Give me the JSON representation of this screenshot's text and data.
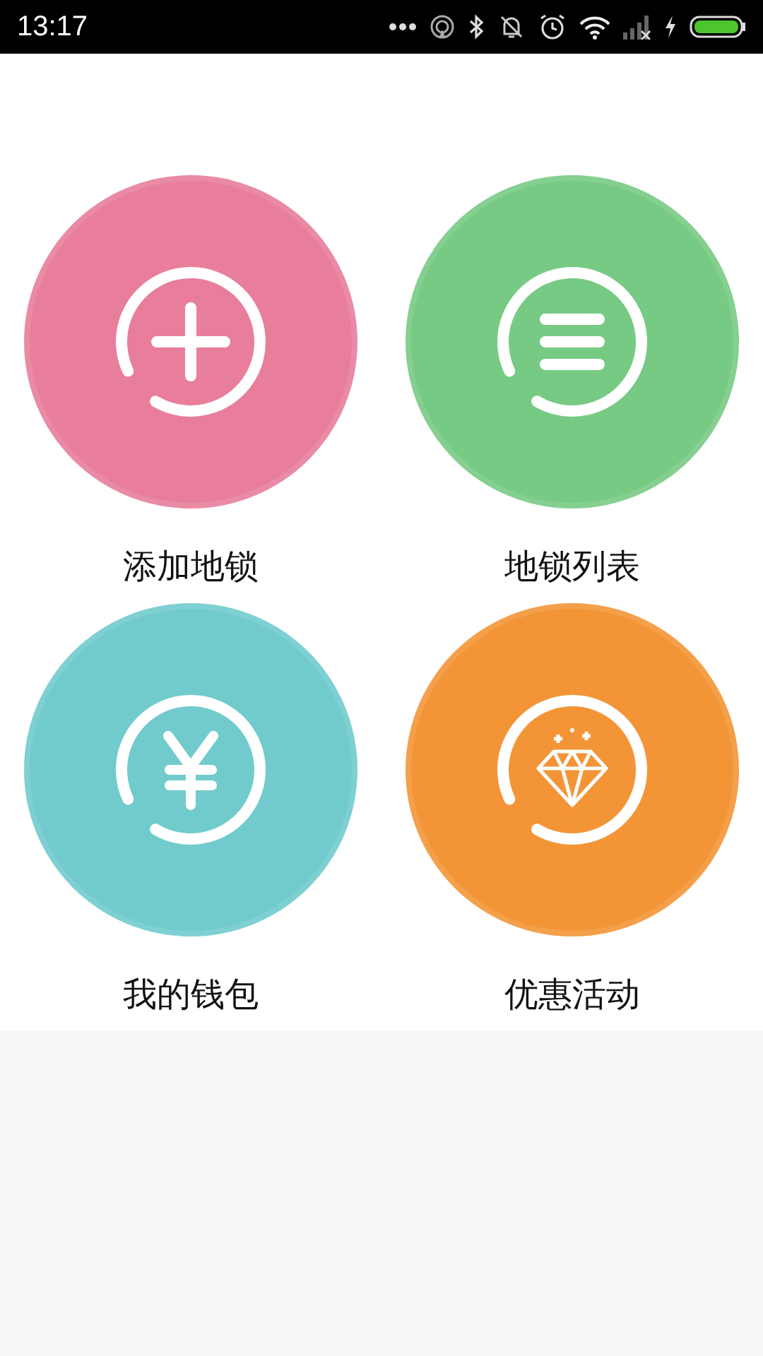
{
  "status_bar": {
    "time": "13:17"
  },
  "tiles": [
    {
      "label": "添加地锁",
      "kind": "plus",
      "color": "#e87e9b"
    },
    {
      "label": "地锁列表",
      "kind": "list",
      "color": "#77ca84"
    },
    {
      "label": "我的钱包",
      "kind": "yen",
      "color": "#71cbcd"
    },
    {
      "label": "优惠活动",
      "kind": "diamond",
      "color": "#f39537"
    }
  ]
}
